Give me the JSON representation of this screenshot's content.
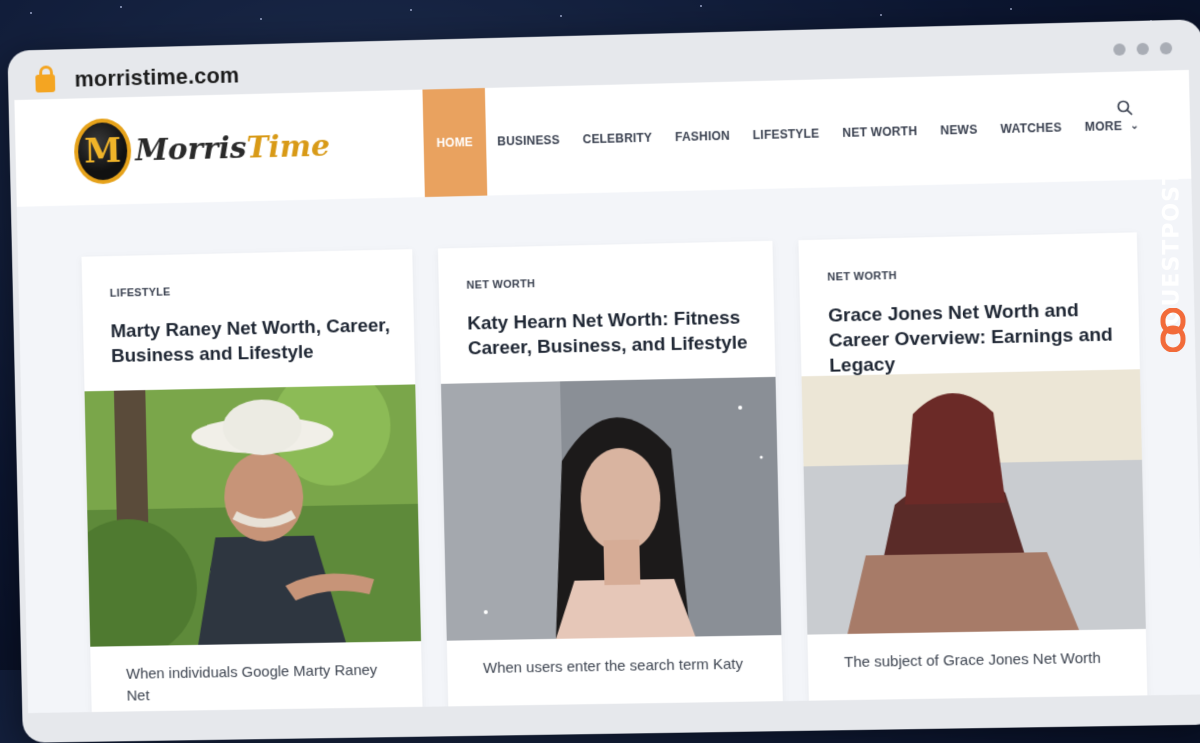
{
  "browser": {
    "url": "morristime.com",
    "lock_icon": "lock-icon"
  },
  "site": {
    "logo_mark": "M",
    "logo_word1": "Morris",
    "logo_word2": "Time",
    "nav": [
      "HOME",
      "BUSINESS",
      "CELEBRITY",
      "FASHION",
      "LIFESTYLE",
      "NET WORTH",
      "NEWS",
      "WATCHES",
      "MORE"
    ],
    "active_nav": "HOME",
    "accent_color": "#e9a25f",
    "brand_gold": "#d89a17"
  },
  "cards": [
    {
      "category": "LIFESTYLE",
      "title": "Marty Raney Net Worth, Career, Business and Lifestyle",
      "excerpt": "When individuals Google Marty Raney Net"
    },
    {
      "category": "NET WORTH",
      "title": "Katy Hearn Net Worth: Fitness Career, Business, and Lifestyle",
      "excerpt": "When users enter the search term Katy"
    },
    {
      "category": "NET WORTH",
      "title": "Grace Jones Net Worth and Career Overview: Earnings and Legacy",
      "excerpt": "The subject of Grace Jones Net Worth"
    }
  ],
  "watermark": {
    "text": "GUESTPOSTLINKS",
    "icon": "link-icon",
    "icon_color": "#f26b3a"
  }
}
